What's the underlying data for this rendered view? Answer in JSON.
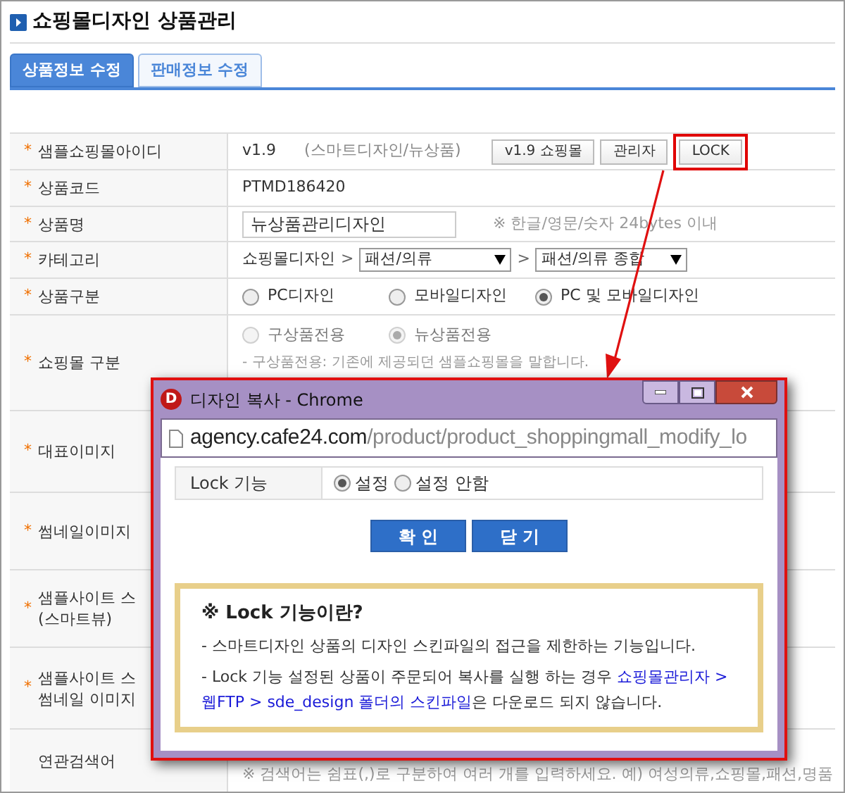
{
  "page_title": "쇼핑몰디자인 상품관리",
  "tabs": [
    {
      "label": "상품정보 수정",
      "selected": true
    },
    {
      "label": "판매정보 수정",
      "selected": false
    }
  ],
  "rows": [
    {
      "kind": "sample_id",
      "marker": "*",
      "label": [
        "샘플쇼핑몰아이디"
      ],
      "version": "v1.9",
      "note": "(스마트디자인/뉴상품)",
      "buttons": [
        {
          "label": "v1.9 쇼핑몰",
          "highlighted": false
        },
        {
          "label": "관리자",
          "highlighted": false
        },
        {
          "label": "LOCK",
          "highlighted": true
        }
      ]
    },
    {
      "kind": "text",
      "marker": "*",
      "label": [
        "상품코드"
      ],
      "value": "PTMD186420"
    },
    {
      "kind": "input",
      "marker": "*",
      "label": [
        "상품명"
      ],
      "value": "뉴상품관리디자인",
      "hint": "※ 한글/영문/숫자 24bytes 이내"
    },
    {
      "kind": "category",
      "marker": "*",
      "label": [
        "카테고리"
      ],
      "root": "쇼핑몰디자인",
      "separator": ">",
      "selects": [
        "패션/의류",
        "패션/의류 종합"
      ]
    },
    {
      "kind": "radio",
      "marker": "*",
      "label": [
        "상품구분"
      ],
      "disabled": false,
      "options": [
        {
          "label": "PC디자인",
          "selected": false
        },
        {
          "label": "모바일디자인",
          "selected": false
        },
        {
          "label": "PC 및 모바일디자인",
          "selected": true
        }
      ],
      "notes": []
    },
    {
      "kind": "radio",
      "marker": "*",
      "label": [
        "쇼핑몰 구분"
      ],
      "disabled": true,
      "options": [
        {
          "label": "구상품전용",
          "selected": false
        },
        {
          "label": "뉴상품전용",
          "selected": true
        }
      ],
      "notes": [
        "- 구상품전용: 기존에 제공되던 샘플쇼핑몰을 말합니다."
      ]
    },
    {
      "kind": "empty",
      "marker": "*",
      "label": [
        "대표이미지"
      ]
    },
    {
      "kind": "empty",
      "marker": "*",
      "label": [
        "썸네일이미지"
      ]
    },
    {
      "kind": "empty",
      "marker": "*",
      "label": [
        "샘플사이트 스",
        "(스마트뷰)"
      ]
    },
    {
      "kind": "empty",
      "marker": "*",
      "label": [
        "샘플사이트 스",
        "썸네일 이미지"
      ]
    },
    {
      "kind": "keywords",
      "label": [
        "연관검색어"
      ],
      "hint": "※ 검색어는 쉼표(,)로 구분하여 여러 개를 입력하세요. 예) 여성의류,쇼핑몰,패션,명품"
    }
  ],
  "popup": {
    "title": "디자인 복사 - Chrome",
    "logo": "D",
    "url_host": "agency.cafe24.com",
    "url_path": "/product/product_shoppingmall_modify_lo",
    "lock_label": "Lock 기능",
    "lock_options": [
      {
        "label": "설정",
        "selected": true
      },
      {
        "label": "설정 안함",
        "selected": false
      }
    ],
    "buttons": [
      "확 인",
      "닫 기"
    ],
    "info_title": "※ Lock 기능이란?",
    "info_lines": [
      {
        "text": "- 스마트디자인 상품의 디자인 스킨파일의 접근을 제한하는 기능입니다."
      },
      {
        "text": "- Lock 기능 설정된 상품이 주문되어 복사를 실행 하는 경우 ",
        "highlight": "쇼핑몰관리자 > 웹FTP > sde_design 폴더의 스킨파일",
        "after": "은 다운로드 되지 않습니다."
      }
    ]
  }
}
